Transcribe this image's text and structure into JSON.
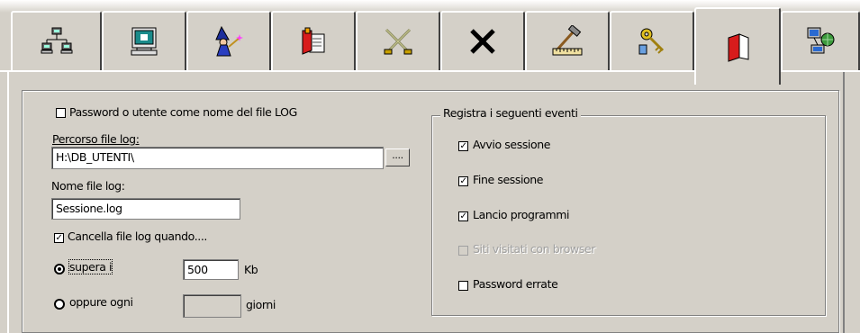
{
  "tabs": [
    {
      "icon": "network-icon",
      "active": false
    },
    {
      "icon": "monitor-icon",
      "active": false
    },
    {
      "icon": "wizard-icon",
      "active": false
    },
    {
      "icon": "file-tools-icon",
      "active": false
    },
    {
      "icon": "crossed-swords-icon",
      "active": false
    },
    {
      "icon": "x-icon",
      "active": false
    },
    {
      "icon": "hammer-ruler-icon",
      "active": false
    },
    {
      "icon": "keys-icon",
      "active": false
    },
    {
      "icon": "log-book-icon",
      "active": true
    },
    {
      "icon": "network-globe-icon",
      "active": false
    }
  ],
  "left": {
    "password_as_log_name": {
      "label": "Password o utente come nome del file LOG",
      "checked": false
    },
    "log_path": {
      "label": "Percorso file log:",
      "value": "H:\\DB_UTENTI\\",
      "browse_label": "...."
    },
    "log_name": {
      "label": "Nome file log:",
      "value": "Sessione.log"
    },
    "delete_log": {
      "label": "Cancella file log quando....",
      "checked": true
    },
    "exceeds": {
      "label": "supera i",
      "value": "500",
      "unit": "Kb",
      "selected": true
    },
    "every": {
      "label": "oppure ogni",
      "value": "",
      "unit": "giorni",
      "selected": false
    }
  },
  "events": {
    "title": "Registra i seguenti eventi",
    "items": [
      {
        "label": "Avvio sessione",
        "checked": true,
        "enabled": true
      },
      {
        "label": "Fine sessione",
        "checked": true,
        "enabled": true
      },
      {
        "label": "Lancio programmi",
        "checked": true,
        "enabled": true
      },
      {
        "label": "Siti visitati con browser",
        "checked": false,
        "enabled": false
      },
      {
        "label": "Password errate",
        "checked": false,
        "enabled": true
      }
    ]
  }
}
